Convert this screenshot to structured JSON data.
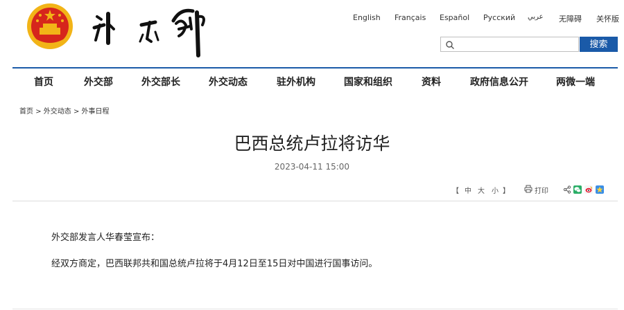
{
  "header": {
    "languages": [
      "English",
      "Français",
      "Español",
      "Русский",
      "عربي",
      "无障碍",
      "关怀版"
    ],
    "search": {
      "placeholder": "",
      "button_label": "搜索"
    },
    "colors": {
      "brand_blue": "#1a5aa8",
      "emblem_red": "#d6261c",
      "emblem_gold": "#f2b417"
    }
  },
  "nav": {
    "items": [
      "首页",
      "外交部",
      "外交部长",
      "外交动态",
      "驻外机构",
      "国家和组织",
      "资料",
      "政府信息公开",
      "两微一端"
    ]
  },
  "breadcrumb": {
    "items": [
      "首页",
      "外交动态",
      "外事日程"
    ],
    "separator": ">"
  },
  "article": {
    "title": "巴西总统卢拉将访华",
    "time": "2023-04-11 15:00",
    "paragraphs": [
      "外交部发言人华春莹宣布：",
      "经双方商定，巴西联邦共和国总统卢拉将于4月12日至15日对中国进行国事访问。"
    ]
  },
  "tools": {
    "bracket_open": "【",
    "size_large": "中",
    "size_medium": "大",
    "size_small": "小",
    "bracket_close": "】",
    "print_label": "打印",
    "share_icons": [
      "share-icon",
      "wechat-icon",
      "weibo-icon",
      "qzone-icon"
    ]
  }
}
